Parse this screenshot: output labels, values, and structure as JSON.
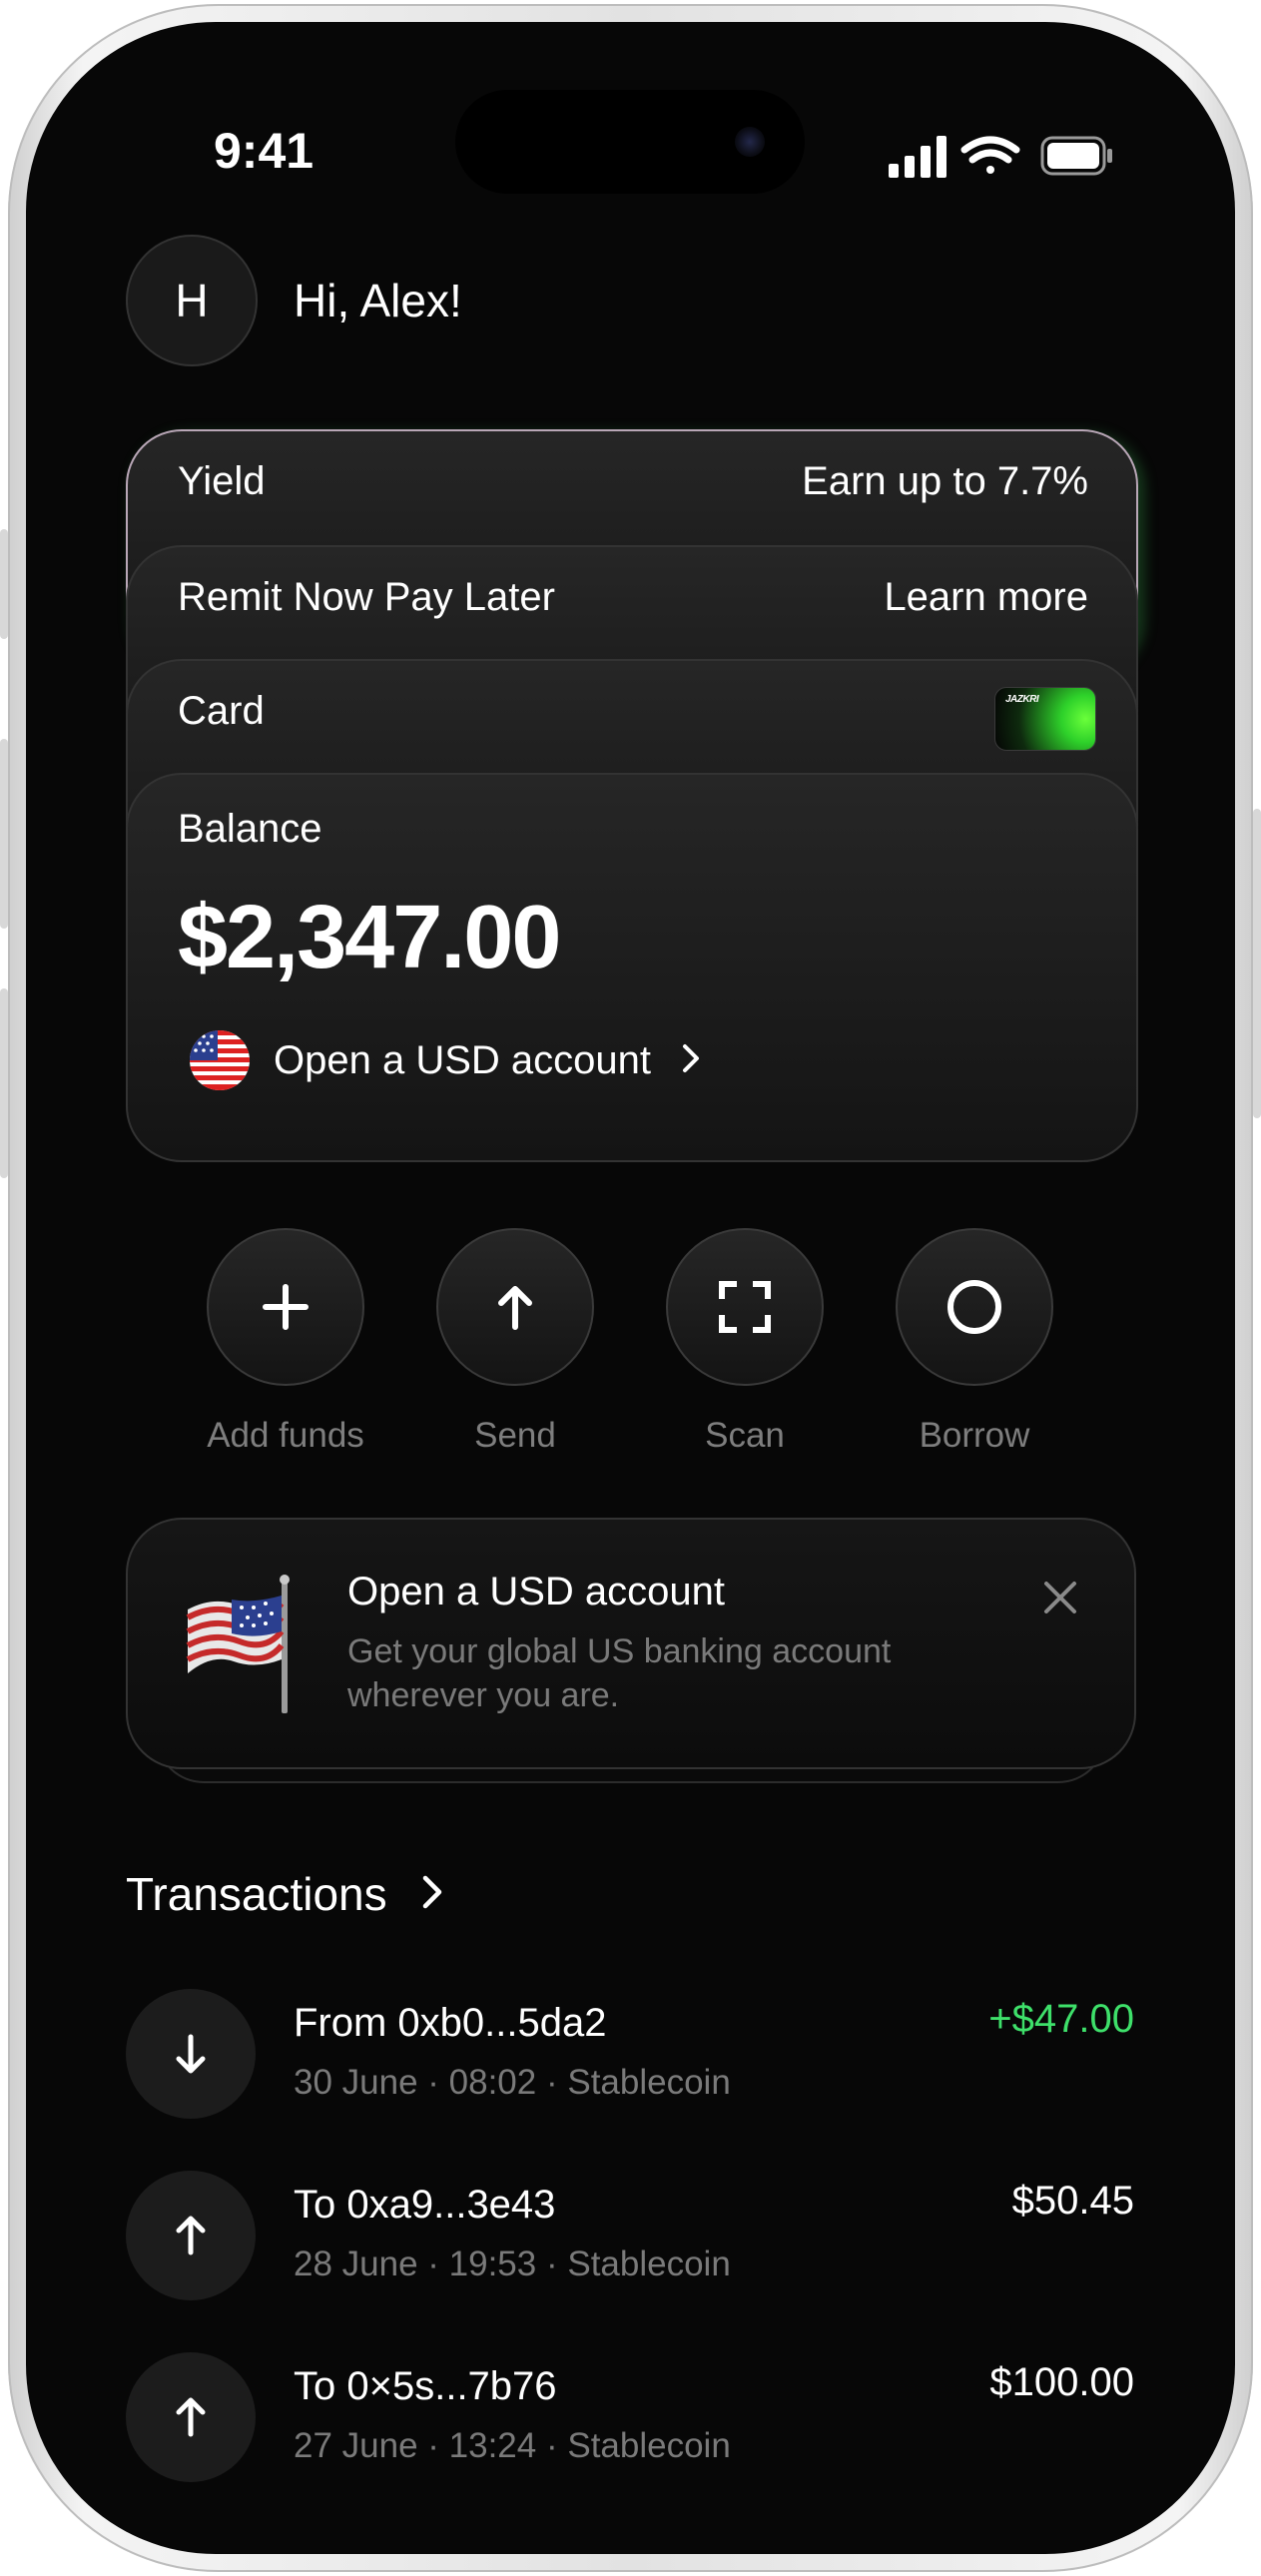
{
  "status_bar": {
    "time": "9:41"
  },
  "header": {
    "avatar_initial": "H",
    "greeting": "Hi, Alex!"
  },
  "stack": {
    "yield": {
      "label": "Yield",
      "right": "Earn up to 7.7%"
    },
    "remit": {
      "label": "Remit Now Pay Later",
      "right": "Learn more"
    },
    "card": {
      "label": "Card",
      "card_brand": "JAZKRI"
    },
    "balance": {
      "label": "Balance",
      "amount": "$2,347.00",
      "usd_link": "Open a USD account"
    }
  },
  "actions": [
    {
      "label": "Add funds",
      "icon": "plus-icon"
    },
    {
      "label": "Send",
      "icon": "arrow-up-icon"
    },
    {
      "label": "Scan",
      "icon": "scan-icon"
    },
    {
      "label": "Borrow",
      "icon": "circle-icon"
    }
  ],
  "promo": {
    "title": "Open a USD account",
    "text": "Get your global US banking account wherever you are."
  },
  "transactions": {
    "title": "Transactions",
    "items": [
      {
        "name": "From 0xb0...5da2",
        "meta": "30 June · 08:02 · Stablecoin",
        "amount": "+$47.00",
        "direction": "in"
      },
      {
        "name": "To 0xa9...3e43",
        "meta": "28 June · 19:53 · Stablecoin",
        "amount": "$50.45",
        "direction": "out"
      },
      {
        "name": "To 0×5s...7b76",
        "meta": "27 June · 13:24 · Stablecoin",
        "amount": "$100.00",
        "direction": "out"
      }
    ]
  },
  "colors": {
    "background": "#070707",
    "positive": "#3ee06a",
    "muted": "#7a7a7a"
  }
}
